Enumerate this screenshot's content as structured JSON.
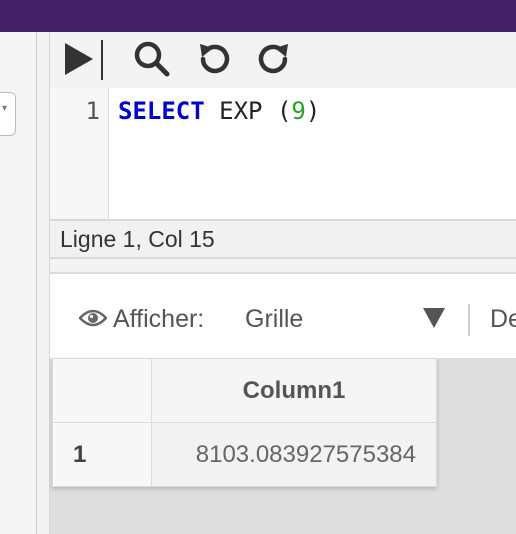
{
  "toolbar": {
    "run_icon": "play-icon",
    "search_icon": "search-icon",
    "undo_icon": "undo-icon",
    "redo_icon": "redo-icon"
  },
  "editor": {
    "line_number": "1",
    "keyword": "SELECT",
    "func": "EXP",
    "open_paren": "(",
    "arg": "9",
    "close_paren": ")"
  },
  "status": {
    "cursor": "Ligne 1, Col 15"
  },
  "results": {
    "view_label": "Afficher:",
    "view_value": "Grille",
    "truncated_label": "De",
    "columns": [
      "Column1"
    ],
    "rows": [
      {
        "index": "1",
        "values": [
          "8103.083927575384"
        ]
      }
    ]
  },
  "colors": {
    "topbar": "#432166",
    "keyword": "#0000cc",
    "number": "#2ea02e"
  }
}
